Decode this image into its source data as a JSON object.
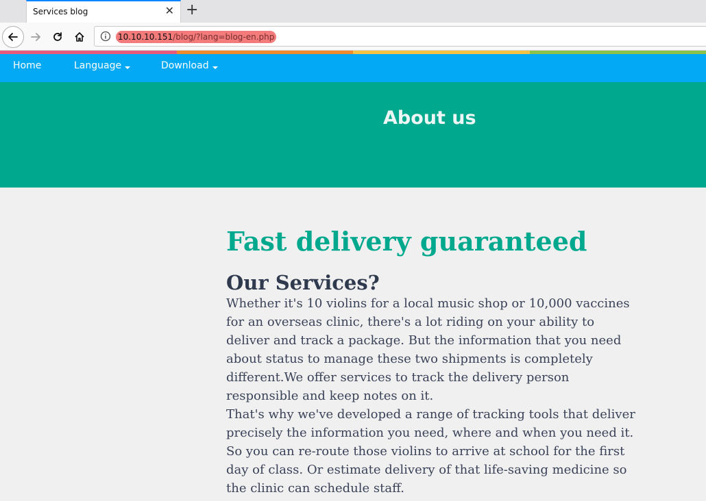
{
  "browser": {
    "tab_title": "Services blog",
    "url_host": "10.10.10.151",
    "url_path": "/blog/?lang=blog-en.php"
  },
  "colorstrip": [
    "#e85a7b",
    "#f08a2c",
    "#f6c244",
    "#8bc34a"
  ],
  "nav": {
    "home": "Home",
    "language": "Language",
    "download": "Download"
  },
  "hero": {
    "title": "About us"
  },
  "content": {
    "heading": "Fast delivery guaranteed",
    "subheading": "Our Services?",
    "paragraph1": "Whether it's 10 violins for a local music shop or 10,000 vaccines for an overseas clinic, there's a lot riding on your ability to deliver and track a package. But the information that you need about status to manage these two shipments is completely different.We offer services to track the delivery person responsible and keep notes on it.",
    "paragraph2": "That's why we've developed a range of tracking tools that deliver precisely the information you need, where and when you need it. So you can re-route those violins to arrive at school for the first day of class. Or estimate delivery of that life-saving medicine so the clinic can schedule staff."
  }
}
